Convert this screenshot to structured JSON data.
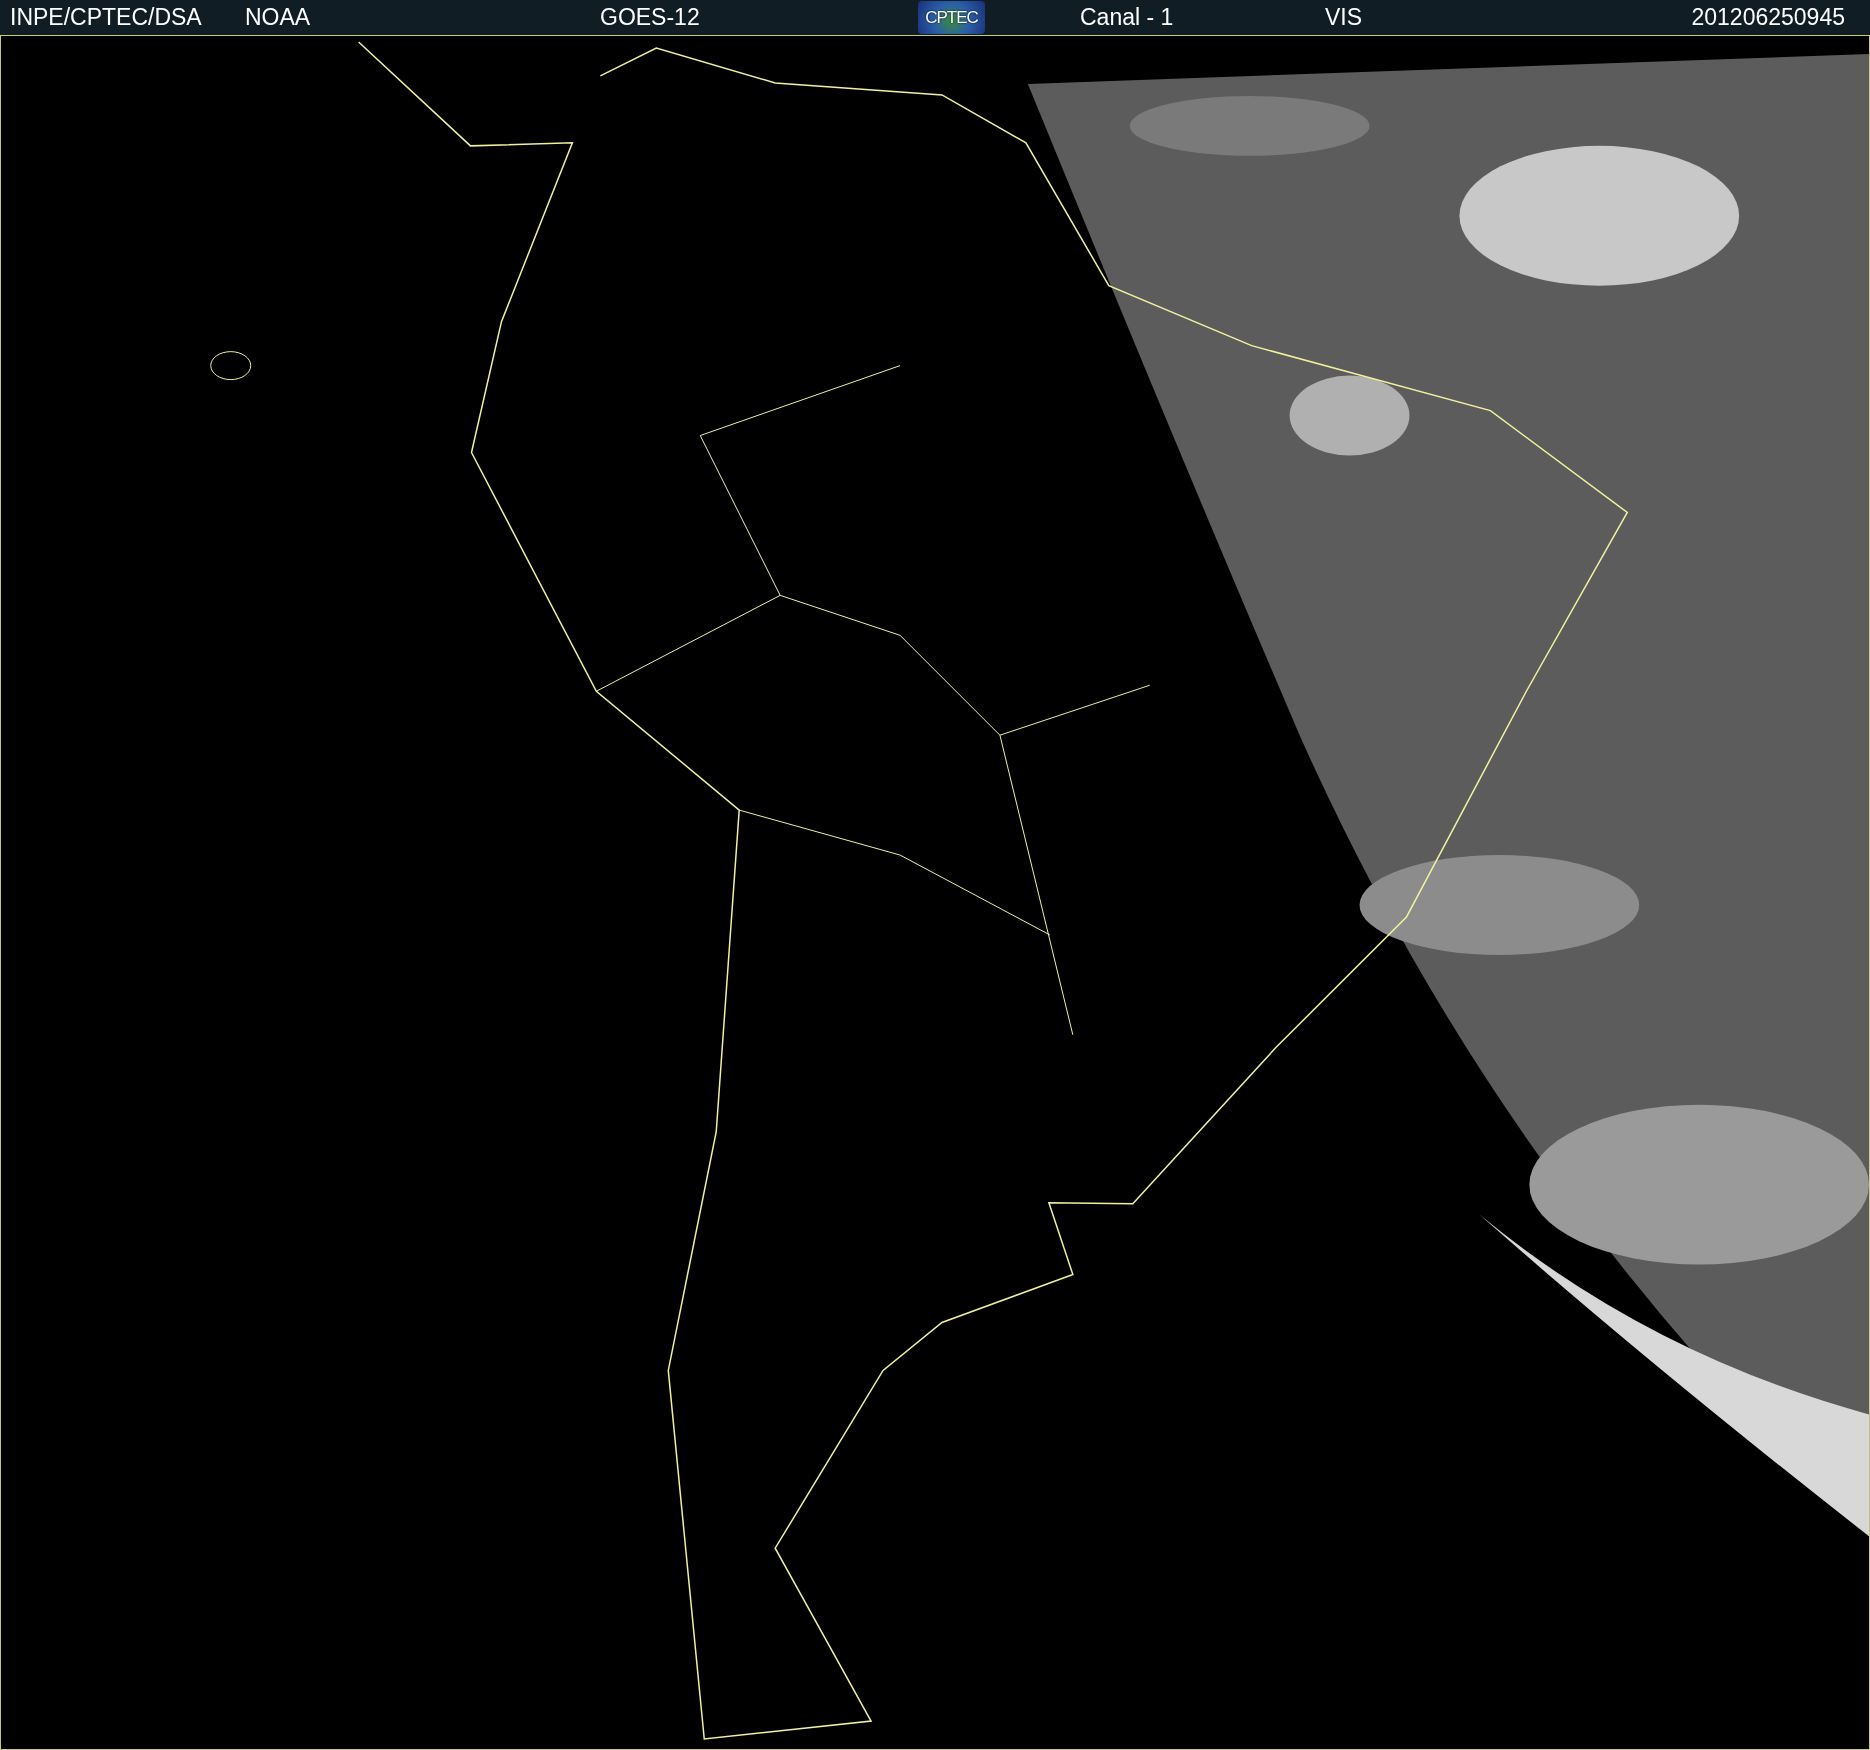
{
  "header": {
    "source": "INPE/CPTEC/DSA",
    "agency": "NOAA",
    "satellite": "GOES-12",
    "logo": "CPTEC",
    "channel": "Canal - 1",
    "band": "VIS",
    "timestamp": "201206250945"
  }
}
